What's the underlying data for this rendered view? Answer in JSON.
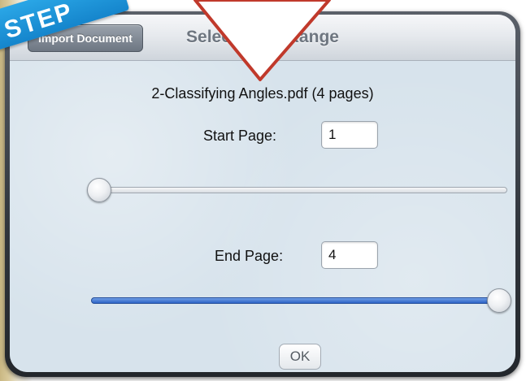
{
  "annotation": {
    "step_badge_text": "STEP"
  },
  "dialog": {
    "back_button_label": "Import Document",
    "title": "Select Page Range",
    "document_label": "2-Classifying Angles.pdf (4 pages)",
    "start_page": {
      "label": "Start Page:",
      "value": "1"
    },
    "start_slider": {
      "value": 1,
      "min": 1,
      "max": 4
    },
    "end_page": {
      "label": "End Page:",
      "value": "4"
    },
    "end_slider": {
      "value": 4,
      "min": 1,
      "max": 4
    },
    "ok_label": "OK"
  },
  "colors": {
    "slider_fill": "#2d63c6",
    "annotation_arrow": "#c0392b",
    "step_badge": "#1e96d8"
  }
}
